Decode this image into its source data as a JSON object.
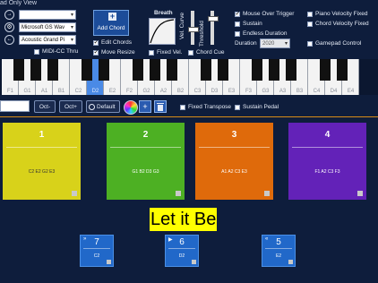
{
  "window": {
    "title": "ad Only View"
  },
  "toolbar": {
    "selects": {
      "top": "",
      "instrument_bank": "Microsoft GS Wav",
      "instrument": "Acoustic Grand Pi"
    },
    "add_chord_label": "Add Chord",
    "edit_chords": {
      "label": "Edit Chords",
      "checked": true
    },
    "move_resize": {
      "label": "Move Resize",
      "checked": true
    },
    "midi_cc_thru": {
      "label": "MIDI-CC Thru",
      "checked": false
    },
    "breath_label": "Breath",
    "vel_curve_label": "Vel. Curve",
    "threshold_label": "Threshold",
    "fixed_vel": {
      "label": "Fixed Vel.",
      "checked": false
    },
    "chord_cue": {
      "label": "Chord Cue",
      "checked": false
    },
    "mouse_over_trigger": {
      "label": "Mouse Over Trigger",
      "checked": true
    },
    "sustain": {
      "label": "Sustain",
      "checked": false
    },
    "endless_duration": {
      "label": "Endless Duration",
      "checked": false
    },
    "duration_label": "Duration",
    "duration_value": "2020",
    "piano_velocity_fixed": {
      "label": "Piano Velocity Fixed",
      "checked": false
    },
    "chord_velocity_fixed": {
      "label": "Chord Velocity Fixed",
      "checked": false
    },
    "gamepad_control": {
      "label": "Gamepad Control",
      "checked": false
    }
  },
  "keyboard": {
    "white_keys": [
      "F1",
      "G1",
      "A1",
      "B1",
      "C2",
      "D2",
      "E2",
      "F2",
      "G2",
      "A2",
      "B2",
      "C3",
      "D3",
      "E3",
      "F3",
      "G3",
      "A3",
      "B3",
      "C4",
      "D4",
      "E4"
    ],
    "active_key": "D2",
    "accent": "#4a8ae6"
  },
  "controls": {
    "oct_minus": "Oct-",
    "oct_plus": "Oct+",
    "default_label": "Default",
    "fixed_transpose": {
      "label": "Fixed Transpose",
      "checked": false
    },
    "sustain_pedal": {
      "label": "Sustain Pedal",
      "checked": false
    }
  },
  "tiles": [
    {
      "num": "1",
      "chords": "C2 E2 G2 E3",
      "color": "#d8d21a"
    },
    {
      "num": "2",
      "chords": "G1 B2 D3 G3",
      "color": "#4db023"
    },
    {
      "num": "3",
      "chords": "A1 A2 C3 E3",
      "color": "#df6a0b"
    },
    {
      "num": "4",
      "chords": "F1 A2 C3 F3",
      "color": "#6322b8"
    }
  ],
  "song_title": "Let it Be",
  "small_tiles": [
    {
      "num": "7",
      "chord": "C2",
      "icon": "»"
    },
    {
      "num": "6",
      "chord": "D2",
      "icon": "▶"
    },
    {
      "num": "5",
      "chord": "E2",
      "icon": "«"
    }
  ]
}
